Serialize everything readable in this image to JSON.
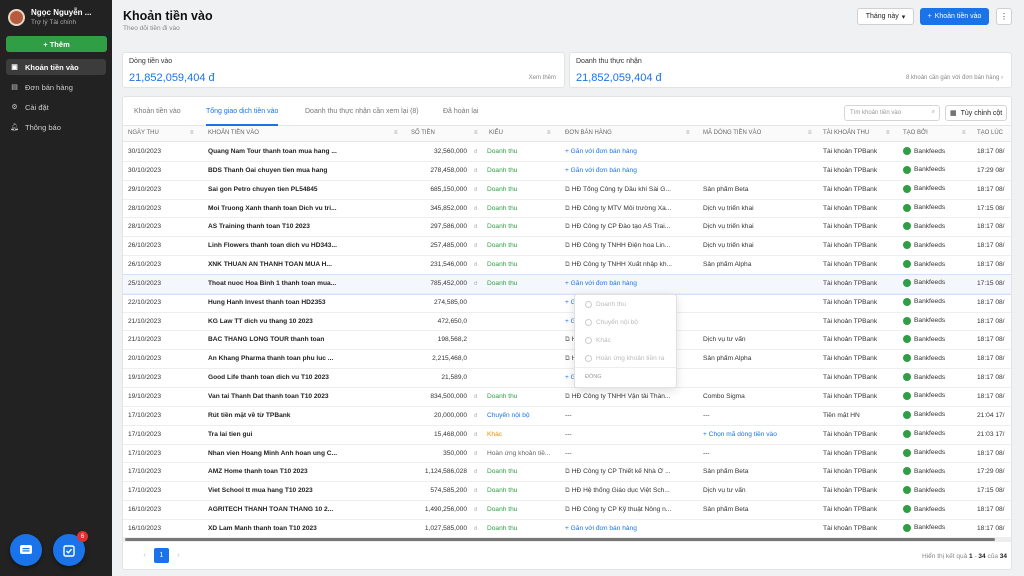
{
  "sidebar": {
    "user_name": "Ngọc Nguyễn ...",
    "user_role": "Trợ lý Tài chính",
    "add_label": "+ Thêm",
    "items": [
      {
        "label": "Khoản tiền vào",
        "icon": "wallet-icon"
      },
      {
        "label": "Đơn bán hàng",
        "icon": "receipt-icon"
      },
      {
        "label": "Cài đặt",
        "icon": "gear-icon"
      },
      {
        "label": "Thông báo",
        "icon": "bell-icon"
      }
    ],
    "badge_count": "6"
  },
  "header": {
    "title": "Khoản tiền vào",
    "subtitle": "Theo dõi tiền đi vào",
    "month_label": "Tháng này",
    "add_in_label": "Khoản tiền vào"
  },
  "cards": {
    "inflow_title": "Dòng tiền vào",
    "inflow_value": "21,852,059,404 đ",
    "inflow_link": "Xem thêm",
    "revenue_title": "Doanh thu thực nhận",
    "revenue_value": "21,852,059,404 đ",
    "revenue_link": "8 khoản cần gán với đơn bán hàng"
  },
  "tabs": [
    "Khoản tiền vào",
    "Tổng giao dịch tiền vào",
    "Doanh thu thực nhận cần xem lại (8)",
    "Đã hoàn lại"
  ],
  "search_placeholder": "Tìm khoản tiền vào",
  "custom_cols_label": "Tùy chỉnh cột",
  "columns": [
    "NGÀY THU",
    "KHOẢN TIỀN VÀO",
    "SỐ TIỀN",
    "KIỂU",
    "ĐƠN BÁN HÀNG",
    "MÃ DÒNG TIỀN VÀO",
    "TÀI KHOẢN THU",
    "TẠO BỞI",
    "TẠO LÚC"
  ],
  "rows": [
    {
      "date": "30/10/2023",
      "name": "Quang Nam Tour thanh toan mua hang ...",
      "amount": "32,560,000",
      "unit": "đ",
      "type": "Doanh thu",
      "type_color": "green",
      "order": "+ Gắn với đơn bán hàng",
      "order_link": true,
      "code": "",
      "acct": "Tài khoản TPBank",
      "by": "Bankfeeds",
      "time": "18:17 08/"
    },
    {
      "date": "30/10/2023",
      "name": "BDS Thanh Oai chuyen tien mua hang",
      "amount": "278,458,000",
      "unit": "đ",
      "type": "Doanh thu",
      "type_color": "green",
      "order": "+ Gắn với đơn bán hàng",
      "order_link": true,
      "code": "",
      "acct": "Tài khoản TPBank",
      "by": "Bankfeeds",
      "time": "17:29 08/"
    },
    {
      "date": "29/10/2023",
      "name": "Sai gon Petro chuyen tien PL54845",
      "amount": "685,150,000",
      "unit": "đ",
      "type": "Doanh thu",
      "type_color": "green",
      "order": "HĐ Tổng Công ty Dầu khí Sài G...",
      "order_link": false,
      "code": "Sản phẩm Beta",
      "acct": "Tài khoản TPBank",
      "by": "Bankfeeds",
      "time": "18:17 08/"
    },
    {
      "date": "28/10/2023",
      "name": "Moi Truong Xanh thanh toan Dich vu tri...",
      "amount": "345,852,000",
      "unit": "đ",
      "type": "Doanh thu",
      "type_color": "green",
      "order": "HĐ Công ty MTV Môi trường Xa...",
      "order_link": false,
      "code": "Dịch vụ triển khai",
      "acct": "Tài khoản TPBank",
      "by": "Bankfeeds",
      "time": "17:15 08/"
    },
    {
      "date": "28/10/2023",
      "name": "AS Training thanh toan T10 2023",
      "amount": "297,586,000",
      "unit": "đ",
      "type": "Doanh thu",
      "type_color": "green",
      "order": "HĐ Công ty CP Đào tạo AS Trai...",
      "order_link": false,
      "code": "Dịch vụ triển khai",
      "acct": "Tài khoản TPBank",
      "by": "Bankfeeds",
      "time": "18:17 08/"
    },
    {
      "date": "26/10/2023",
      "name": "Linh Flowers thanh toan dich vu HD343...",
      "amount": "257,485,000",
      "unit": "đ",
      "type": "Doanh thu",
      "type_color": "green",
      "order": "HĐ Công ty TNHH Điện hoa Lin...",
      "order_link": false,
      "code": "Dịch vụ triển khai",
      "acct": "Tài khoản TPBank",
      "by": "Bankfeeds",
      "time": "18:17 08/"
    },
    {
      "date": "26/10/2023",
      "name": "XNK THUAN AN THANH TOAN MUA H...",
      "amount": "231,546,000",
      "unit": "đ",
      "type": "Doanh thu",
      "type_color": "green",
      "order": "HĐ Công ty TNHH Xuất nhập kh...",
      "order_link": false,
      "code": "Sản phẩm Alpha",
      "acct": "Tài khoản TPBank",
      "by": "Bankfeeds",
      "time": "18:17 08/"
    },
    {
      "date": "25/10/2023",
      "name": "Thoat nuoc Hoa Binh 1 thanh toan mua...",
      "amount": "785,452,000",
      "unit": "đ",
      "type": "Doanh thu",
      "type_color": "green",
      "order": "+ Gắn với đơn bán hàng",
      "order_link": true,
      "code": "",
      "acct": "Tài khoản TPBank",
      "by": "Bankfeeds",
      "time": "17:15 08/"
    },
    {
      "date": "22/10/2023",
      "name": "Hung Hanh Invest thanh toan HD2353",
      "amount": "274,585,00",
      "unit": "",
      "type": "",
      "type_color": "green",
      "order": "+ Gắn với đơn bán hàng",
      "order_link": true,
      "code": "",
      "acct": "Tài khoản TPBank",
      "by": "Bankfeeds",
      "time": "18:17 08/"
    },
    {
      "date": "21/10/2023",
      "name": "KG Law TT dich vu thang 10 2023",
      "amount": "472,650,0",
      "unit": "",
      "type": "",
      "type_color": "green",
      "order": "+ Gắn với đơn bán hàng",
      "order_link": true,
      "code": "",
      "acct": "Tài khoản TPBank",
      "by": "Bankfeeds",
      "time": "18:17 08/"
    },
    {
      "date": "21/10/2023",
      "name": "BAC THANG LONG TOUR thanh toan",
      "amount": "198,568,2",
      "unit": "",
      "type": "",
      "type_color": "green",
      "order": "HĐ Công ty TNHH Du lịch Bắc T...",
      "order_link": false,
      "code": "Dịch vụ tư vấn",
      "acct": "Tài khoản TPBank",
      "by": "Bankfeeds",
      "time": "18:17 08/"
    },
    {
      "date": "20/10/2023",
      "name": "An Khang Pharma thanh toan phu luc ...",
      "amount": "2,215,468,0",
      "unit": "",
      "type": "",
      "type_color": "green",
      "order": "HĐ Công ty TM Dược phẩm An ...",
      "order_link": false,
      "code": "Sản phẩm Alpha",
      "acct": "Tài khoản TPBank",
      "by": "Bankfeeds",
      "time": "18:17 08/"
    },
    {
      "date": "19/10/2023",
      "name": "Good Life thanh toan dich vu T10 2023",
      "amount": "21,589,0",
      "unit": "",
      "type": "",
      "type_color": "green",
      "order": "+ Gắn với đơn bán hàng",
      "order_link": true,
      "code": "",
      "acct": "Tài khoản TPBank",
      "by": "Bankfeeds",
      "time": "18:17 08/"
    },
    {
      "date": "19/10/2023",
      "name": "Van tai Thanh Dat thanh toan T10 2023",
      "amount": "834,500,000",
      "unit": "đ",
      "type": "Doanh thu",
      "type_color": "green",
      "order": "HĐ Công ty TNHH Vận tải Thàn...",
      "order_link": false,
      "code": "Combo Sigma",
      "acct": "Tài khoản TPBank",
      "by": "Bankfeeds",
      "time": "18:17 08/"
    },
    {
      "date": "17/10/2023",
      "name": "Rút tiền mặt về từ TPBank",
      "amount": "20,000,000",
      "unit": "đ",
      "type": "Chuyển nội bộ",
      "type_color": "blue",
      "order": "---",
      "order_link": false,
      "code": "---",
      "acct": "Tiền mặt HN",
      "by": "Bankfeeds",
      "time": "21:04 17/"
    },
    {
      "date": "17/10/2023",
      "name": "Tra lai tien gui",
      "amount": "15,468,000",
      "unit": "đ",
      "type": "Khác",
      "type_color": "orange",
      "order": "---",
      "order_link": false,
      "code": "+ Chọn mã dòng tiền vào",
      "acct": "Tài khoản TPBank",
      "by": "Bankfeeds",
      "time": "21:03 17/"
    },
    {
      "date": "17/10/2023",
      "name": "Nhan vien Hoang Minh Anh hoan ung C...",
      "amount": "350,000",
      "unit": "đ",
      "type": "Hoàn ứng khoản tiề...",
      "type_color": "gray",
      "order": "---",
      "order_link": false,
      "code": "---",
      "acct": "Tài khoản TPBank",
      "by": "Bankfeeds",
      "time": "18:17 08/"
    },
    {
      "date": "17/10/2023",
      "name": "AMZ Home thanh toan T10 2023",
      "amount": "1,124,586,028",
      "unit": "đ",
      "type": "Doanh thu",
      "type_color": "green",
      "order": "HĐ Công ty CP Thiết kế Nhà Ở ...",
      "order_link": false,
      "code": "Sản phẩm Beta",
      "acct": "Tài khoản TPBank",
      "by": "Bankfeeds",
      "time": "17:29 08/"
    },
    {
      "date": "17/10/2023",
      "name": "Viet School tt mua hang T10 2023",
      "amount": "574,585,200",
      "unit": "đ",
      "type": "Doanh thu",
      "type_color": "green",
      "order": "HĐ Hệ thống Giáo dục Việt Sch...",
      "order_link": false,
      "code": "Dịch vụ tư vấn",
      "acct": "Tài khoản TPBank",
      "by": "Bankfeeds",
      "time": "17:15 08/"
    },
    {
      "date": "16/10/2023",
      "name": "AGRITECH THANH TOAN THANG 10 2...",
      "amount": "1,490,256,000",
      "unit": "đ",
      "type": "Doanh thu",
      "type_color": "green",
      "order": "HĐ Công ty CP Kỹ thuật Nông n...",
      "order_link": false,
      "code": "Sản phẩm Beta",
      "acct": "Tài khoản TPBank",
      "by": "Bankfeeds",
      "time": "18:17 08/"
    },
    {
      "date": "16/10/2023",
      "name": "XD Lam Manh thanh toan T10 2023",
      "amount": "1,027,585,000",
      "unit": "đ",
      "type": "Doanh thu",
      "type_color": "green",
      "order": "+ Gắn với đơn bán hàng",
      "order_link": true,
      "code": "",
      "acct": "Tài khoản TPBank",
      "by": "Bankfeeds",
      "time": "18:17 08/"
    }
  ],
  "dropdown": {
    "options": [
      "Doanh thu",
      "Chuyển nội bộ",
      "Khác",
      "Hoàn ứng khoản tiền ra"
    ],
    "footer": "ĐÓNG"
  },
  "pager": {
    "current": "1",
    "info_prefix": "Hiển thị kết quả",
    "info_from": "1",
    "info_dash": "-",
    "info_to": "34",
    "info_of": "của",
    "info_total": "34"
  }
}
